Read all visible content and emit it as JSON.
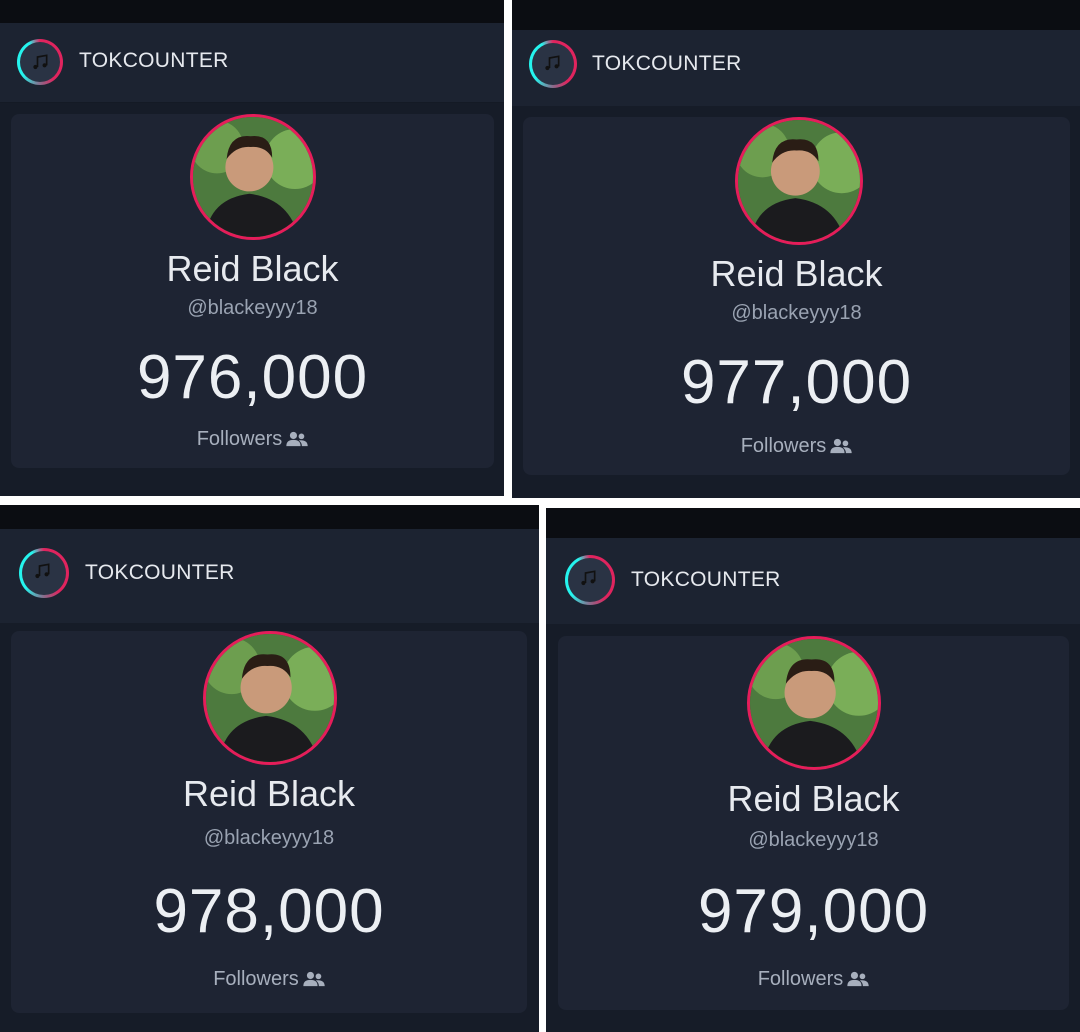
{
  "app": {
    "brand": "TOKCOUNTER"
  },
  "profile": {
    "name": "Reid Black",
    "handle": "@blackeyyy18",
    "followers_label": "Followers"
  },
  "snapshots": [
    {
      "followers": "976,000"
    },
    {
      "followers": "977,000"
    },
    {
      "followers": "978,000"
    },
    {
      "followers": "979,000"
    }
  ],
  "colors": {
    "header_bg": "#1c2331",
    "card_bg": "#1e2433",
    "avatar_ring": "#e51d5a",
    "logo_pink": "#e0245e",
    "logo_cyan": "#25f4ee"
  },
  "icons": {
    "logo": "music-note-icon",
    "followers": "users-icon"
  }
}
